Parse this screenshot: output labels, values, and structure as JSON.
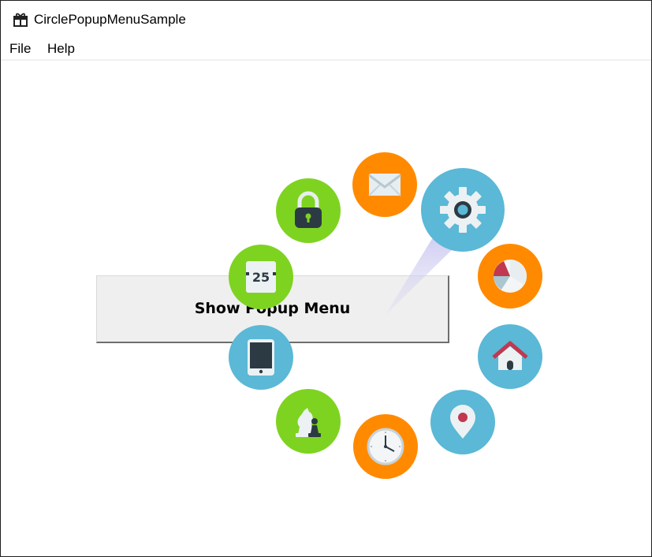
{
  "window": {
    "title": "CirclePopupMenuSample"
  },
  "menu": {
    "items": [
      {
        "label": "File"
      },
      {
        "label": "Help"
      }
    ]
  },
  "main": {
    "button_label": "Show Popup Menu"
  },
  "popup_menu": {
    "center_icon": "settings-gear-icon",
    "items": [
      {
        "icon": "mail-envelope-icon",
        "color": "#ff8a00"
      },
      {
        "icon": "padlock-icon",
        "color": "#7ed321"
      },
      {
        "icon": "calendar-icon",
        "color": "#7ed321",
        "text": "25"
      },
      {
        "icon": "tablet-icon",
        "color": "#5bb8d6"
      },
      {
        "icon": "chess-knight-icon",
        "color": "#7ed321"
      },
      {
        "icon": "clock-icon",
        "color": "#ff8a00"
      },
      {
        "icon": "map-pin-icon",
        "color": "#5bb8d6"
      },
      {
        "icon": "home-icon",
        "color": "#5bb8d6"
      },
      {
        "icon": "pie-chart-icon",
        "color": "#ff8a00"
      }
    ],
    "colors": {
      "orange": "#ff8a00",
      "green": "#7ed321",
      "blue": "#5bb8d6"
    }
  }
}
